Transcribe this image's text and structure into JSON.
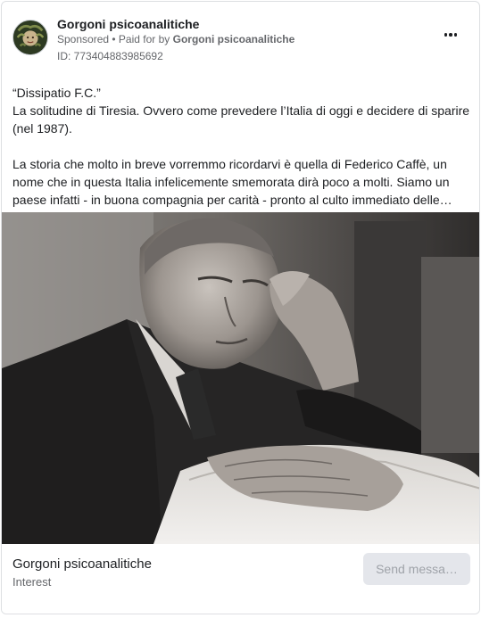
{
  "ad": {
    "page_name": "Gorgoni psicoanalitiche",
    "sponsored_label": "Sponsored",
    "paid_for_prefix": " • Paid for by ",
    "paid_for_name": "Gorgoni psicoanalitiche",
    "ad_id": "ID: 773404883985692",
    "more_icon": "more-horizontal-icon",
    "body": {
      "line1": "“Dissipatio F.C.”",
      "line2": "La solitudine di Tiresia. Ovvero come prevedere l’Italia di oggi e decidere di sparire (nel 1987).",
      "line3": "La storia che molto in breve vorremmo ricordarvi è quella di Federico Caffè, un nome che in questa Italia infelicemente smemorata dirà poco a molti. Siamo un paese infatti - in buona compagnia per carità - pronto al culto immediato delle…"
    },
    "image_alt": "Black and white photo of an elderly man resting his head on his hand, reading",
    "footer": {
      "name": "Gorgoni psicoanalitiche",
      "category": "Interest",
      "cta_label": "Send messa…"
    }
  },
  "colors": {
    "text_primary": "#1c1e21",
    "text_secondary": "#65676b",
    "button_bg": "#e4e6eb",
    "button_text": "#9fa3a9"
  }
}
